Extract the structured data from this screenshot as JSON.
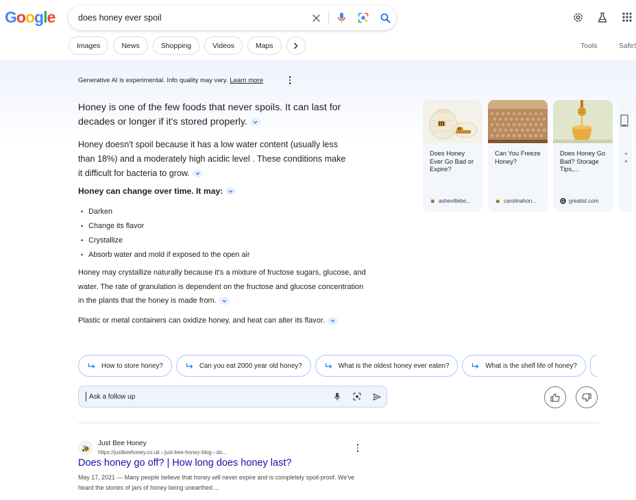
{
  "header": {
    "logo": "Google",
    "query": "does honey ever spoil",
    "icons": [
      "clear-icon",
      "mic-icon",
      "lens-icon",
      "search-icon",
      "settings-icon",
      "labs-icon",
      "apps-icon"
    ]
  },
  "tabs": {
    "items": [
      "Images",
      "News",
      "Shopping",
      "Videos",
      "Maps"
    ],
    "more": "more-tabs-arrow-icon",
    "tools": "Tools",
    "safesearch": "SafeS"
  },
  "ai_overview": {
    "notice": "Generative AI is experimental. Info quality may vary.",
    "learn_more": "Learn more",
    "p1": "Honey is one of the few foods that never spoils. It can last for decades or longer if it's stored properly.",
    "p2": "Honey doesn't spoil because it has a low water content (usually less than 18%) and a moderately high acidic level . These conditions make it difficult for bacteria to grow.",
    "heading": "Honey can change over time. It may:",
    "bullets": [
      "Darken",
      "Change its flavor",
      "Crystallize",
      "Absorb water and mold if exposed to the open air"
    ],
    "p3": "Honey may crystallize naturally because it's a mixture of fructose sugars, glucose, and water. The rate of granulation is dependent on the fructose and glucose concentration in the plants that the honey is made from.",
    "p4": "Plastic or metal containers can oxidize honey, and heat can alter its flavor."
  },
  "cards": [
    {
      "title": "Does Honey Ever Go Bad or Expire?",
      "source": "ashevillebe..."
    },
    {
      "title": "Can You Freeze Honey?",
      "source": "carolinahon..."
    },
    {
      "title": "Does Honey Go Bad? Storage Tips,...",
      "source": "greatist.com"
    }
  ],
  "followups": [
    "How to store honey?",
    "Can you eat 2000 year old honey?",
    "What is the oldest honey ever eaten?",
    "What is the shelf life of honey?"
  ],
  "followup_input": {
    "placeholder": "Ask a follow up"
  },
  "result": {
    "site_name": "Just Bee Honey",
    "url": "https://justbeehoney.co.uk › just-bee-honey-blog › do...",
    "title": "Does honey go off? | How long does honey last?",
    "snippet": "May 17, 2021 — Many people believe that honey will never expire and is completely spoil-proof. We've heard the stories of jars of honey being unearthed ..."
  },
  "colors": {
    "link": "#1a0dab",
    "accent_blue": "#1a73e8",
    "chip_border": "#a8c7fa",
    "ai_bg": "#eef3fc"
  }
}
